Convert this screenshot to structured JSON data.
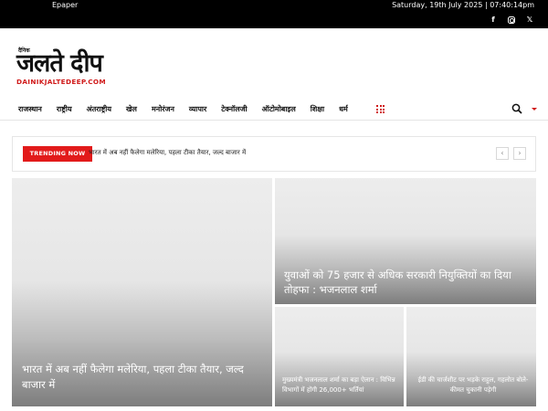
{
  "topbar": {
    "epaper": "Epaper",
    "datetime": "Saturday, 19th July 2025 | 07:40:14pm",
    "social_icons": [
      "facebook-icon",
      "instagram-icon",
      "x-twitter-icon"
    ]
  },
  "logo": {
    "small": "दैनिक",
    "main": "जलते दीप",
    "sub": "DAINIKJALTEDEEP.COM",
    "brand_color": "#d01a1a"
  },
  "nav": {
    "items": [
      "राजस्थान",
      "राष्ट्रीय",
      "अंतराष्ट्रीय",
      "खेल",
      "मनोरंजन",
      "व्यापार",
      "टेक्नॉलजी",
      "ऑटोमोबाइल",
      "शिक्षा",
      "धर्म"
    ]
  },
  "trending": {
    "badge": "TRENDING NOW",
    "headline": "भारत में अब नहीं फैलेगा मलेरिया, पहला टीका तैयार, जल्द बाजार में",
    "prev": "‹",
    "next": "›",
    "badge_color": "#e21b1b"
  },
  "articles": {
    "big": "भारत में अब नहीं फैलेगा मलेरिया, पहला टीका तैयार, जल्द बाजार में",
    "top": "युवाओं को 75 हजार से अधिक सरकारी नियुक्तियों का दिया तोहफा : भजनलाल शर्मा",
    "small1": "मुख्यमंत्री भजनलाल शर्मा का बड़ा ऐलान : विभिन्न विभागों में होंगी 26,000+ भर्तियां",
    "small2": "ईडी की चार्जशीट पर भड़के राहुल, गहलोत बोले- कीमत चुकानी पड़ेगी"
  }
}
